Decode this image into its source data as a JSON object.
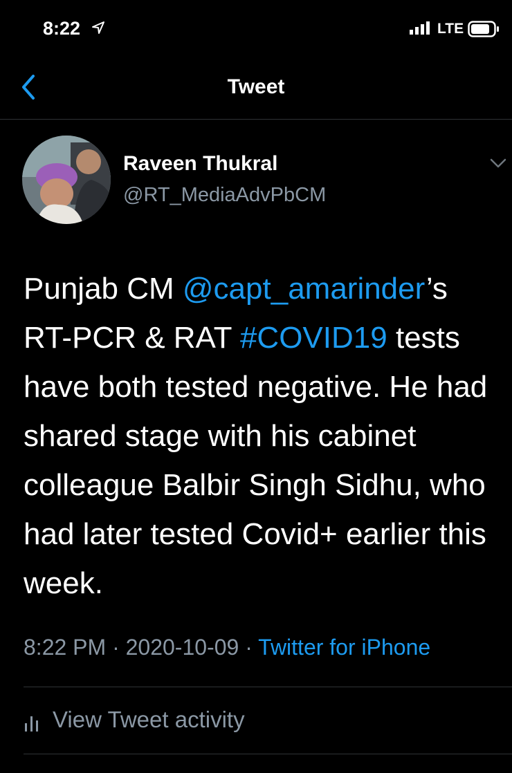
{
  "status_bar": {
    "time": "8:22",
    "network": "LTE",
    "icons": [
      "location-arrow-icon",
      "signal-bars-icon",
      "battery-icon"
    ]
  },
  "nav": {
    "title": "Tweet",
    "back_icon": "chevron-left-icon"
  },
  "tweet": {
    "author": {
      "name": "Raveen Thukral",
      "handle": "@RT_MediaAdvPbCM",
      "avatar_icon": "profile-photo"
    },
    "more_icon": "chevron-down-icon",
    "body": {
      "part1": "Punjab CM ",
      "mention": "@capt_amarinder",
      "part2": "’s RT-PCR & RAT ",
      "hashtag": "#COVID19",
      "part3": " tests have both tested negative. He had shared stage with his cabinet colleague Balbir Singh Sidhu, who had later tested Covid+ earlier this week."
    },
    "time": "8:22 PM",
    "separator": " · ",
    "date": "2020-10-09",
    "source": "Twitter for iPhone"
  },
  "activity": {
    "label": "View Tweet activity",
    "icon": "bar-chart-icon"
  },
  "colors": {
    "background": "#000000",
    "link": "#1d9bf0",
    "secondary": "#8b98a5",
    "divider": "#2f3336"
  }
}
